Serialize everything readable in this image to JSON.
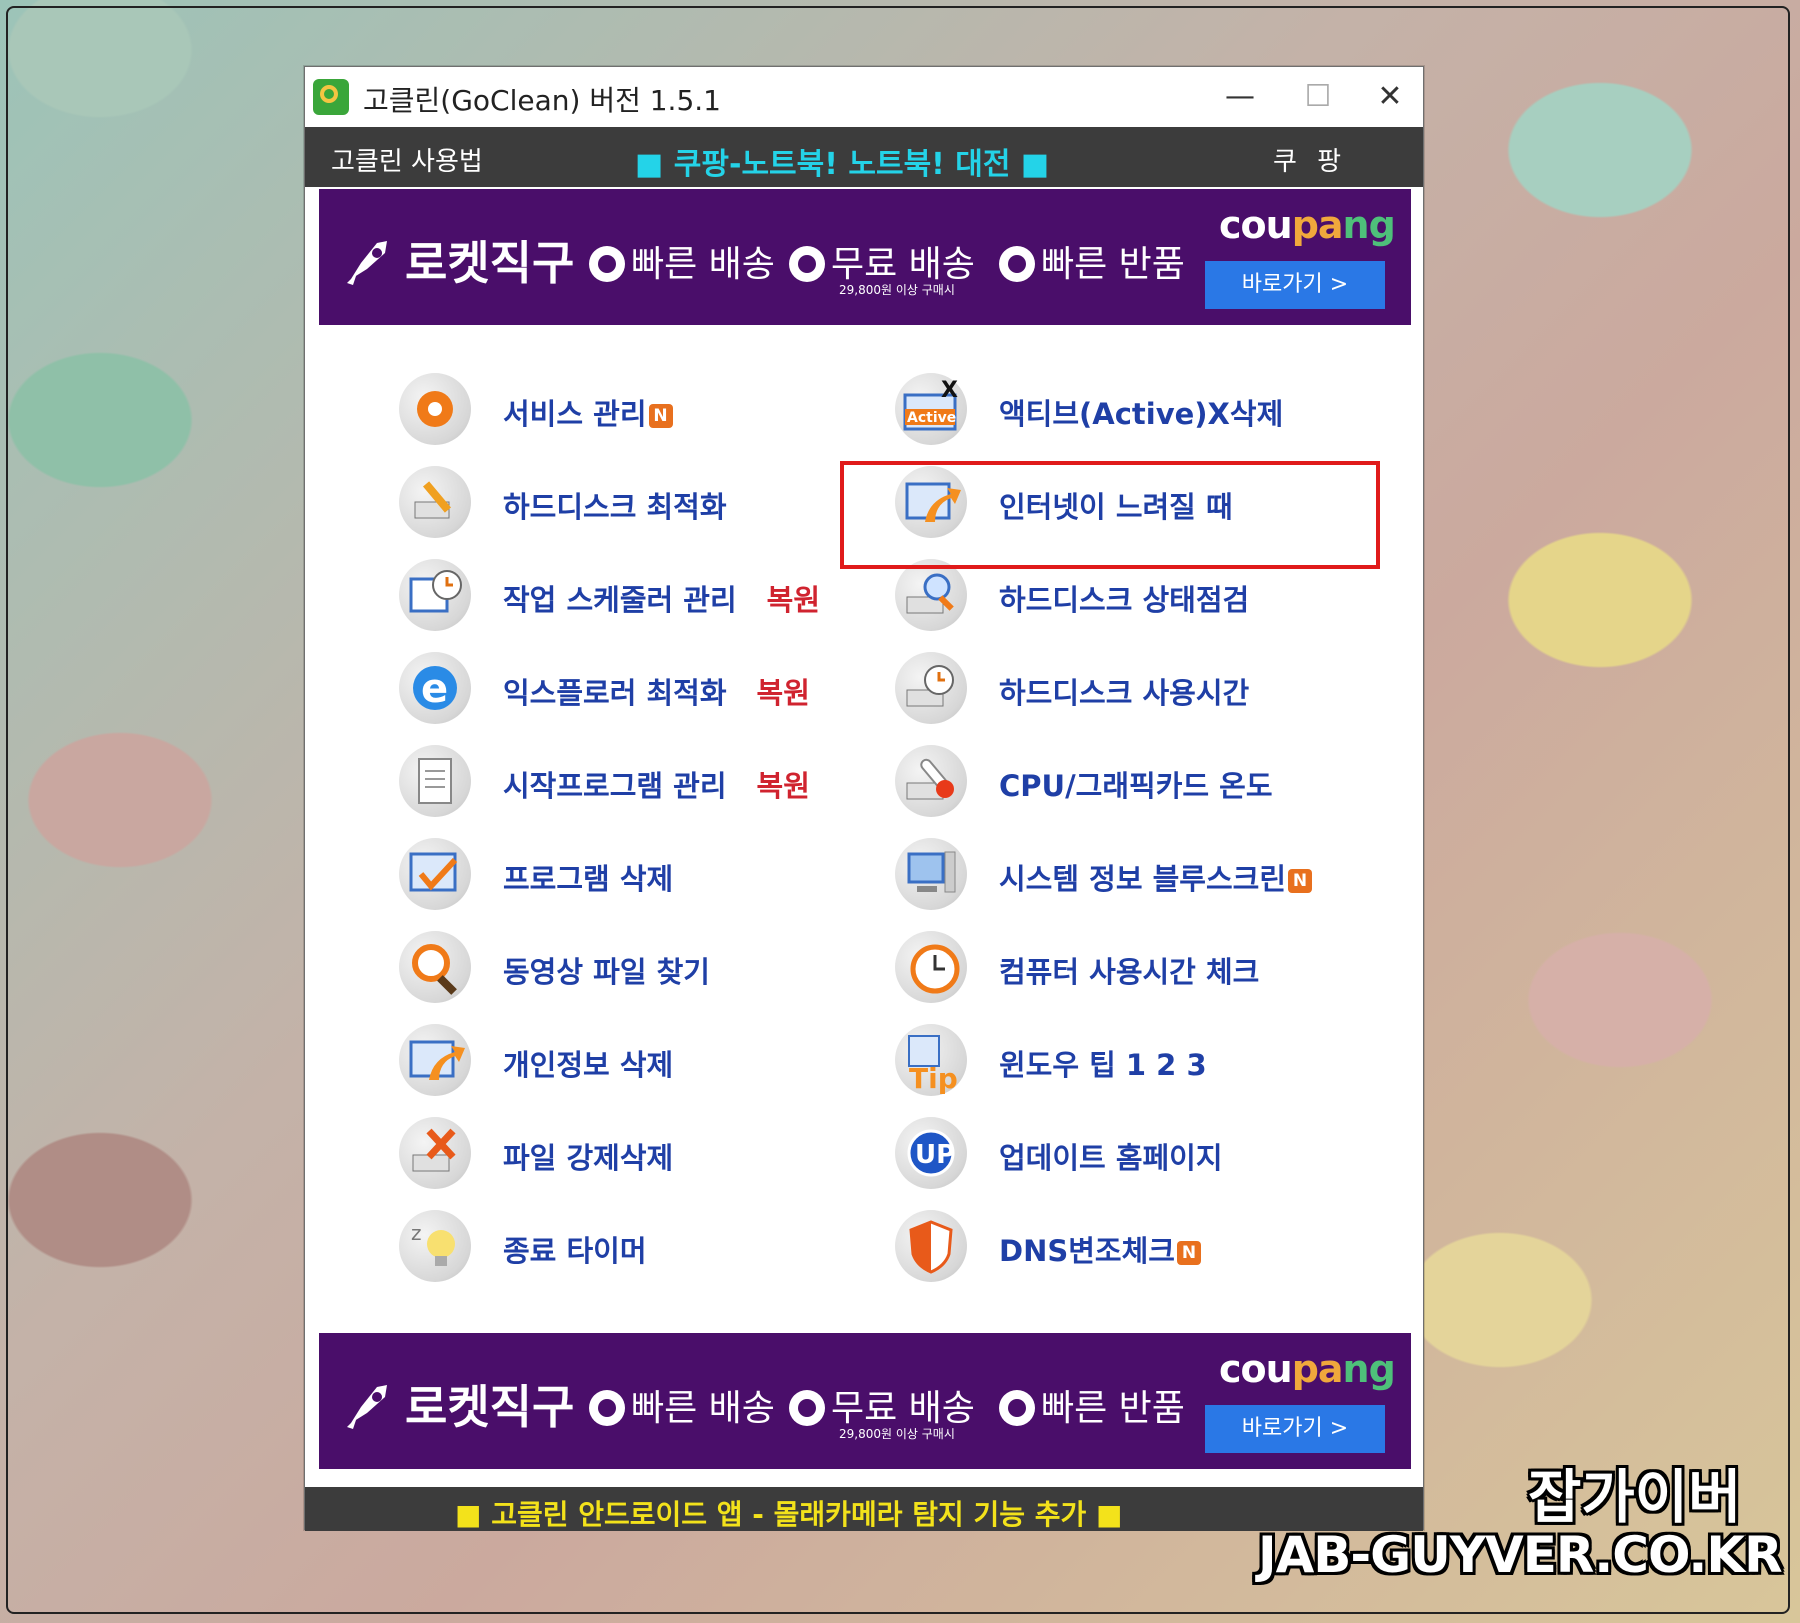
{
  "window": {
    "title": "고클린(GoClean) 버전 1.5.1",
    "minimize": "—",
    "maximize": "☐",
    "close": "✕"
  },
  "menubar": {
    "left": "고클린 사용법",
    "center": "■ 쿠팡-노트북! 노트북! 대전 ■",
    "right": "쿠 팡"
  },
  "banner": {
    "title": "로켓직구",
    "feature1": "빠른 배송",
    "feature2": "무료 배송",
    "feature3": "빠른 반품",
    "subnote": "29,800원 이상 구매시",
    "brand_a": "cou",
    "brand_b": "pa",
    "brand_c": "ng",
    "goto": "바로가기 >"
  },
  "left_items": [
    {
      "label": "서비스 관리",
      "extra": "",
      "badge": "N",
      "icon": "gear-icon"
    },
    {
      "label": "하드디스크 최적화",
      "extra": "",
      "badge": "",
      "icon": "wrench-disk-icon"
    },
    {
      "label": "작업 스케줄러 관리",
      "extra": "복원",
      "badge": "",
      "icon": "scheduler-clock-icon"
    },
    {
      "label": "익스플로러 최적화",
      "extra": "복원",
      "badge": "",
      "icon": "ie-icon"
    },
    {
      "label": "시작프로그램 관리",
      "extra": "복원",
      "badge": "",
      "icon": "document-icon"
    },
    {
      "label": "프로그램 삭제",
      "extra": "",
      "badge": "",
      "icon": "checklist-icon"
    },
    {
      "label": "동영상 파일 찾기",
      "extra": "",
      "badge": "",
      "icon": "magnifier-icon"
    },
    {
      "label": "개인정보 삭제",
      "extra": "",
      "badge": "",
      "icon": "window-arrow-icon"
    },
    {
      "label": "파일 강제삭제",
      "extra": "",
      "badge": "",
      "icon": "delete-x-icon"
    },
    {
      "label": "종료 타이머",
      "extra": "",
      "badge": "",
      "icon": "sleep-bulb-icon"
    }
  ],
  "right_items": [
    {
      "label": "액티브(Active)X삭제",
      "extra": "",
      "badge": "",
      "icon": "activex-icon"
    },
    {
      "label": "인터넷이 느려질 때",
      "extra": "",
      "badge": "",
      "icon": "window-arrow-icon"
    },
    {
      "label": "하드디스크 상태점검",
      "extra": "",
      "badge": "",
      "icon": "disk-search-icon"
    },
    {
      "label": "하드디스크 사용시간",
      "extra": "",
      "badge": "",
      "icon": "disk-clock-icon"
    },
    {
      "label": "CPU/그래픽카드 온도",
      "extra": "",
      "badge": "",
      "icon": "thermometer-icon"
    },
    {
      "label": "시스템 정보  블루스크린",
      "extra": "",
      "badge": "N",
      "icon": "computer-icon"
    },
    {
      "label": "컴퓨터 사용시간 체크",
      "extra": "",
      "badge": "",
      "icon": "clock-icon"
    },
    {
      "label": "윈도우 팁 1    2    3",
      "extra": "",
      "badge": "",
      "icon": "tip-icon"
    },
    {
      "label": "업데이트      홈페이지",
      "extra": "",
      "badge": "",
      "icon": "update-icon"
    },
    {
      "label": "DNS변조체크",
      "extra": "",
      "badge": "N",
      "icon": "shield-icon"
    }
  ],
  "bottombar": "■ 고클린 안드로이드 앱 - 몰래카메라 탐지 기능 추가 ■",
  "watermark": {
    "line1": "잡가이버",
    "line2": "JAB-GUYVER.CO.KR"
  },
  "colors": {
    "label_blue": "#1f3fa6",
    "restore_red": "#d0232f",
    "banner_purple": "#4a0e6a",
    "menubar_gray": "#3c3c3c",
    "highlight_red": "#e01a1a"
  }
}
